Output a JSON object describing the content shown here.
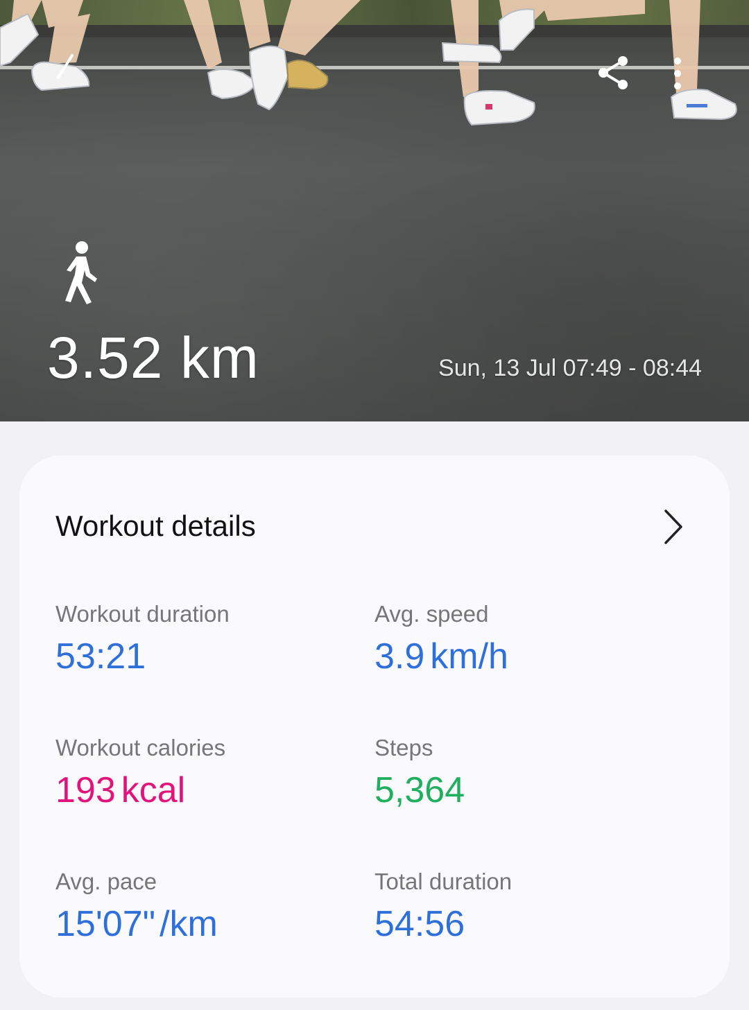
{
  "header": {
    "distance": "3.52 km",
    "time_range": "Sun, 13 Jul 07:49 - 08:44",
    "activity_icon": "walking-person-icon",
    "actions": {
      "back_icon": "back-arrow-icon",
      "share_icon": "share-icon",
      "more_icon": "more-vert-icon"
    }
  },
  "workout_details": {
    "title": "Workout details",
    "stats": [
      {
        "label": "Workout duration",
        "value": "53:21",
        "unit": "",
        "color": "#2f6fd9"
      },
      {
        "label": "Avg. speed",
        "value": "3.9",
        "unit": "km/h",
        "color": "#2f6fd9"
      },
      {
        "label": "Workout calories",
        "value": "193",
        "unit": "kcal",
        "color": "#e2147c"
      },
      {
        "label": "Steps",
        "value": "5,364",
        "unit": "",
        "color": "#1faf5f"
      },
      {
        "label": "Avg. pace",
        "value": "15'07\"",
        "unit": "/km",
        "color": "#2f6fd9"
      },
      {
        "label": "Total duration",
        "value": "54:56",
        "unit": "",
        "color": "#2f6fd9"
      }
    ]
  }
}
